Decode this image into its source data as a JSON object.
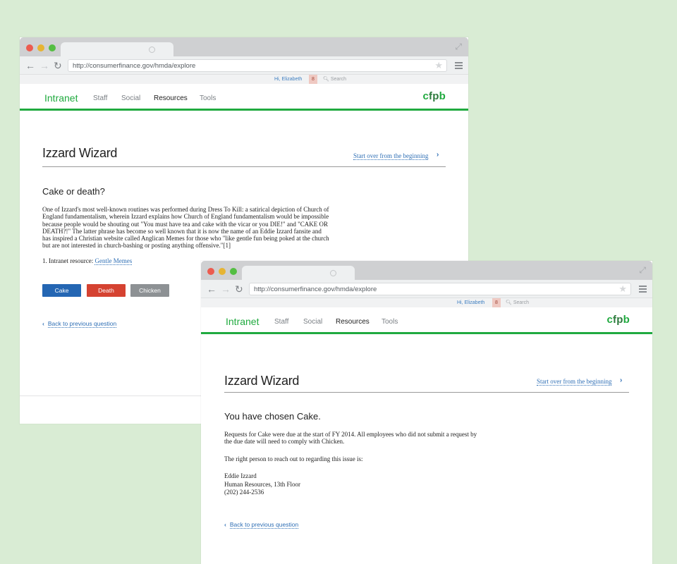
{
  "browser": {
    "url": "http://consumerfinance.gov/hmda/explore",
    "user_greeting": "Hi, Elizabeth",
    "notification_count": "8",
    "search_placeholder": "Search"
  },
  "nav": {
    "brand": "Intranet",
    "items": [
      "Staff",
      "Social",
      "Resources",
      "Tools"
    ],
    "active_item": "Resources",
    "logo": {
      "part1": "c",
      "part2": "f",
      "part3": "p",
      "part4": "b"
    }
  },
  "colors": {
    "background": "#d9ecd4",
    "accent_green": "#20aa3f",
    "link_blue": "#2f6fb5",
    "cake_button": "#2466b3",
    "death_button": "#d54231",
    "chicken_button": "#8d9194"
  },
  "window1": {
    "title": "Izzard Wizard",
    "start_over": "Start over from the beginning",
    "question": "Cake or death?",
    "paragraph_lines": [
      "One of Izzard's most well-known routines was performed during Dress To Kill: a satirical depiction of Church of",
      "England fundamentalism, wherein Izzard explains how Church of England fundamentalism would be impossible",
      "because people would be shouting out \"You must have tea and cake with the vicar or you DIE!\" and \"CAKE OR",
      "DEATH?!\" The latter phrase has become so well known that it is now the name of an Eddie Izzard fansite and",
      "has inspired a Christian website called Anglican Memes for those who \"like gentle fun being poked at the church",
      "but are not interested in church-bashing or posting anything offensive.\"[1]"
    ],
    "footnote_prefix": "1. Intranet resource: ",
    "footnote_link": "Gentle Memes",
    "buttons": {
      "cake": "Cake",
      "death": "Death",
      "chicken": "Chicken"
    },
    "back_link": "Back to previous question"
  },
  "window2": {
    "title": "Izzard Wizard",
    "start_over": "Start over from the beginning",
    "heading": "You have chosen Cake.",
    "para1_lines": [
      "Requests for Cake were due at the start of FY 2014. All employees who did not submit a request by",
      "the due date will need to comply with Chicken."
    ],
    "para2": "The right person to reach out to regarding this issue is:",
    "contact_lines": [
      "Eddie Izzard",
      "Human Resources, 13th Floor",
      "(202) 244-2536"
    ],
    "back_link": "Back to previous question"
  }
}
